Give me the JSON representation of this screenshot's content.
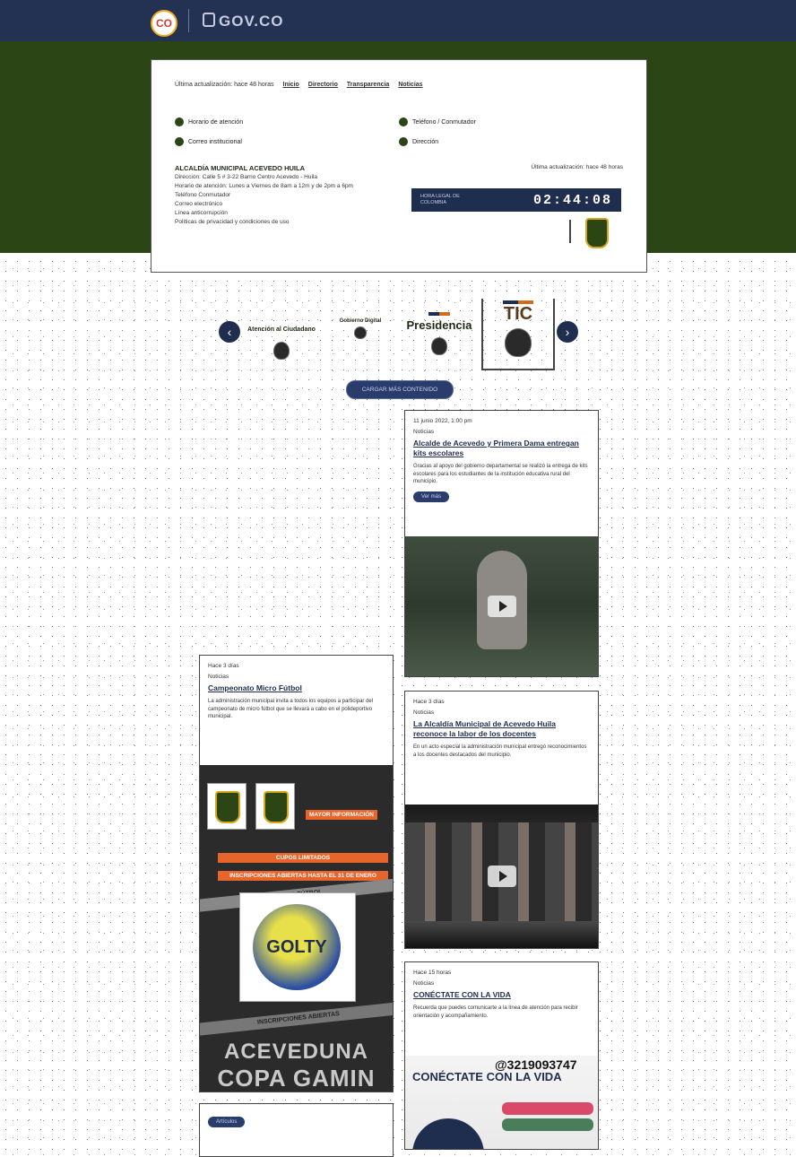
{
  "header": {
    "logo_co": "CO",
    "logo_govco": "GOV.CO"
  },
  "breadcrumb": {
    "last_update": "Última actualización: hace 48 horas",
    "links": [
      "Inicio",
      "Directorio",
      "Transparencia",
      "Noticias"
    ]
  },
  "contacts": [
    {
      "label": "Horario de atención"
    },
    {
      "label": "Correo institucional"
    },
    {
      "label": "Teléfono / Conmutador"
    },
    {
      "label": "Dirección"
    }
  ],
  "entity": {
    "name": "ALCALDÍA MUNICIPAL ACEVEDO HUILA",
    "address": "Dirección: Calle 5 # 3-22 Barrio Centro Acevedo - Huila",
    "hours": "Horario de atención: Lunes a Viernes de 8am a 12m y de 2pm a 6pm",
    "phone": "Teléfono Conmutador",
    "email": "Correo electrónico",
    "extra": "Línea anticorrupción",
    "policy": "Políticas de privacidad y condiciones de uso"
  },
  "clock": {
    "label": "HORA LEGAL DE COLOMBIA",
    "time": "02:44:08"
  },
  "carousel": {
    "items": [
      {
        "label": "Atención al Ciudadano"
      },
      {
        "label": "Gobierno Digital"
      },
      {
        "label": "Presidencia"
      },
      {
        "label": "TIC"
      }
    ],
    "prev_icon": "chevron-left-icon",
    "next_icon": "chevron-right-icon"
  },
  "load_more": "CARGAR MÁS CONTENIDO",
  "cards": {
    "c1": {
      "date": "11 junio 2022, 1:00 pm",
      "category": "Noticias",
      "title": "Alcalde de Acevedo y Primera Dama entregan kits escolares",
      "excerpt": "Gracias al apoyo del gobierno departamental se realizó la entrega de kits escolares para los estudiantes de la institución educativa rural del municipio.",
      "tag": "Ver más"
    },
    "c2": {
      "date": "Hace 3 días",
      "category": "Noticias",
      "title": "Campeonato Micro Fútbol",
      "excerpt": "La administración municipal invita a todos los equipos a participar del campeonato de micro fútbol que se llevará a cabo en el polideportivo municipal."
    },
    "c3": {
      "date": "Hace 3 días",
      "category": "Noticias",
      "title": "La Alcaldía Municipal de Acevedo Huila reconoce la labor de los docentes",
      "excerpt": "En un acto especial la administración municipal entregó reconocimientos a los docentes destacados del municipio."
    },
    "c4": {
      "date": "Hace 15 horas",
      "category": "Noticias",
      "title": "CONÉCTATE CON LA VIDA",
      "excerpt": "Recuerda que puedes comunicarte a la línea de atención para recibir orientación y acompañamiento."
    },
    "c5": {
      "tag": "Artículos"
    }
  },
  "poster": {
    "title_line1": "COPA GAMIN",
    "title_line2": "ACEVEDUNA",
    "stripe1": "INSCRIPCIONES ABIERTAS",
    "stripe2": "MICRO FÚTBOL",
    "orange1": "INSCRIPCIONES ABIERTAS HASTA EL 31 DE ENERO",
    "orange2": "CUPOS LIMITADOS",
    "info": "MAYOR INFORMACIÓN",
    "ball_text": "GOLTY"
  },
  "vida": {
    "phone": "@3219093747",
    "brand": "CONÉCTATE CON LA VIDA"
  },
  "colors": {
    "topbar": "#233152",
    "green": "#2c4515",
    "accent": "#d36b1b",
    "navy": "#1f2d4e"
  }
}
